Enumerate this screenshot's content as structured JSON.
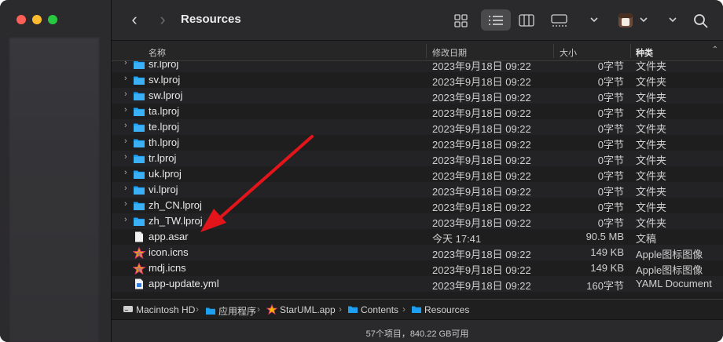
{
  "window": {
    "title": "Resources"
  },
  "toolbar": {
    "back_icon": "chevron-left-icon",
    "forward_icon": "chevron-right-icon",
    "view_icons": [
      "icon-view-icon",
      "list-view-icon",
      "column-view-icon",
      "gallery-view-icon"
    ],
    "active_view": "list-view-icon",
    "search_icon": "search-icon"
  },
  "columns": {
    "name": "名称",
    "date": "修改日期",
    "size": "大小",
    "kind": "种类"
  },
  "rows": [
    {
      "name": "sr.lproj",
      "date": "2023年9月18日 09:22",
      "size": "0字节",
      "kind": "文件夹",
      "type": "folder"
    },
    {
      "name": "sv.lproj",
      "date": "2023年9月18日 09:22",
      "size": "0字节",
      "kind": "文件夹",
      "type": "folder"
    },
    {
      "name": "sw.lproj",
      "date": "2023年9月18日 09:22",
      "size": "0字节",
      "kind": "文件夹",
      "type": "folder"
    },
    {
      "name": "ta.lproj",
      "date": "2023年9月18日 09:22",
      "size": "0字节",
      "kind": "文件夹",
      "type": "folder"
    },
    {
      "name": "te.lproj",
      "date": "2023年9月18日 09:22",
      "size": "0字节",
      "kind": "文件夹",
      "type": "folder"
    },
    {
      "name": "th.lproj",
      "date": "2023年9月18日 09:22",
      "size": "0字节",
      "kind": "文件夹",
      "type": "folder"
    },
    {
      "name": "tr.lproj",
      "date": "2023年9月18日 09:22",
      "size": "0字节",
      "kind": "文件夹",
      "type": "folder"
    },
    {
      "name": "uk.lproj",
      "date": "2023年9月18日 09:22",
      "size": "0字节",
      "kind": "文件夹",
      "type": "folder"
    },
    {
      "name": "vi.lproj",
      "date": "2023年9月18日 09:22",
      "size": "0字节",
      "kind": "文件夹",
      "type": "folder"
    },
    {
      "name": "zh_CN.lproj",
      "date": "2023年9月18日 09:22",
      "size": "0字节",
      "kind": "文件夹",
      "type": "folder"
    },
    {
      "name": "zh_TW.lproj",
      "date": "2023年9月18日 09:22",
      "size": "0字节",
      "kind": "文件夹",
      "type": "folder"
    },
    {
      "name": "app.asar",
      "date": "今天 17:41",
      "size": "90.5 MB",
      "kind": "文稿",
      "type": "document"
    },
    {
      "name": "icon.icns",
      "date": "2023年9月18日 09:22",
      "size": "149 KB",
      "kind": "Apple图标图像",
      "type": "icns"
    },
    {
      "name": "mdj.icns",
      "date": "2023年9月18日 09:22",
      "size": "149 KB",
      "kind": "Apple图标图像",
      "type": "icns"
    },
    {
      "name": "app-update.yml",
      "date": "2023年9月18日 09:22",
      "size": "160字节",
      "kind": "YAML Document",
      "type": "yaml"
    }
  ],
  "pathbar": [
    "Macintosh HD",
    "应用程序",
    "StarUML.app",
    "Contents",
    "Resources"
  ],
  "status": "57个项目，840.22 GB可用",
  "colors": {
    "folder": "#1ea0f2",
    "arrow": "#e3151b",
    "accent_star": "#f5b400"
  }
}
